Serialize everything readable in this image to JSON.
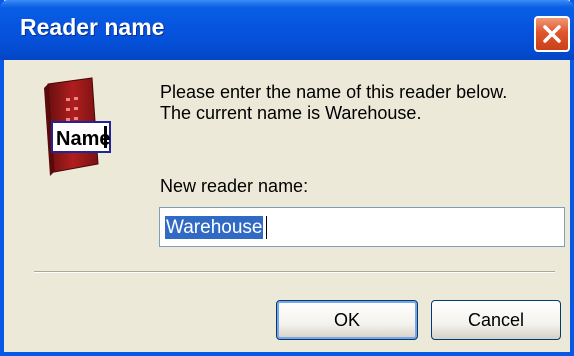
{
  "window": {
    "title": "Reader name"
  },
  "prompt": {
    "line1": "Please enter the name of this reader below.",
    "line2": "The current name is Warehouse."
  },
  "field": {
    "label": "New reader name:",
    "value": "Warehouse"
  },
  "icon": {
    "name": "reader-name-icon",
    "label": "Name"
  },
  "buttons": {
    "ok": "OK",
    "cancel": "Cancel"
  },
  "colors": {
    "titlebar": "#0654e0",
    "close": "#e0562c",
    "selection": "#316ac5",
    "face": "#ece9d8"
  }
}
